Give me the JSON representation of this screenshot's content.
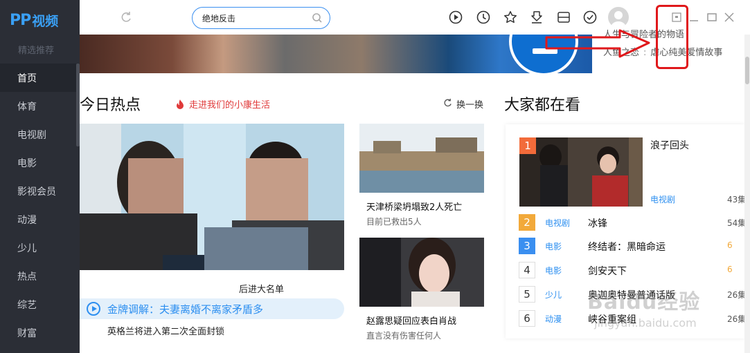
{
  "app": {
    "logo_pp": "PP",
    "logo_text": "视频"
  },
  "sidebar": {
    "featured_label": "精选推荐",
    "items": [
      {
        "label": "首页",
        "active": true
      },
      {
        "label": "体育"
      },
      {
        "label": "电视剧"
      },
      {
        "label": "电影"
      },
      {
        "label": "影视会员"
      },
      {
        "label": "动漫"
      },
      {
        "label": "少儿"
      },
      {
        "label": "热点"
      },
      {
        "label": "综艺"
      },
      {
        "label": "财富"
      }
    ]
  },
  "search": {
    "value": "绝地反击",
    "placeholder": ""
  },
  "toolbar": {
    "icons": [
      "play-icon",
      "history-icon",
      "star-icon",
      "download-icon",
      "storage-icon",
      "check-icon",
      "avatar",
      "mini-mode-icon",
      "minimize-icon",
      "maximize-icon",
      "close-icon"
    ]
  },
  "banner": {
    "lines": [
      {
        "title": "",
        "desc": "人生与冒险者的物语"
      },
      {
        "title": "人鱼之恋",
        "desc": "虐心纯美爱情故事"
      }
    ]
  },
  "hot": {
    "title": "今日热点",
    "promo": "走进我们的小康生活",
    "swap": "换一换",
    "hero_caption_tail": "后进大名单",
    "hero_pill": "金牌调解：夫妻离婚不离家矛盾多",
    "hero_sub": "英格兰将进入第二次全面封锁",
    "cards": [
      {
        "title": "天津桥梁坍塌致2人死亡",
        "sub": "目前已救出5人"
      },
      {
        "title": "赵露思疑回应表白肖战",
        "sub": "直言没有伤害任何人"
      }
    ]
  },
  "trending": {
    "title": "大家都在看",
    "first": {
      "rank": "1",
      "title": "浪子回头",
      "category": "电视剧",
      "count": "43集"
    },
    "rows": [
      {
        "rank": "2",
        "category": "电视剧",
        "title": "冰锋",
        "count": "54集"
      },
      {
        "rank": "3",
        "category": "电影",
        "title": "终结者：黑暗命运",
        "count": "6"
      },
      {
        "rank": "4",
        "category": "电影",
        "title": "剑安天下",
        "count": "6"
      },
      {
        "rank": "5",
        "category": "少儿",
        "title": "奥迦奥特曼普通话版",
        "count": "26集"
      },
      {
        "rank": "6",
        "category": "动漫",
        "title": "峡谷重案组",
        "count": "26集"
      }
    ],
    "rank_colors": [
      "#f26b3a",
      "#f2a93a",
      "#3a8ff0"
    ]
  },
  "watermark": {
    "main": "Baidu经验",
    "sub": "jingyan.baidu.com"
  }
}
